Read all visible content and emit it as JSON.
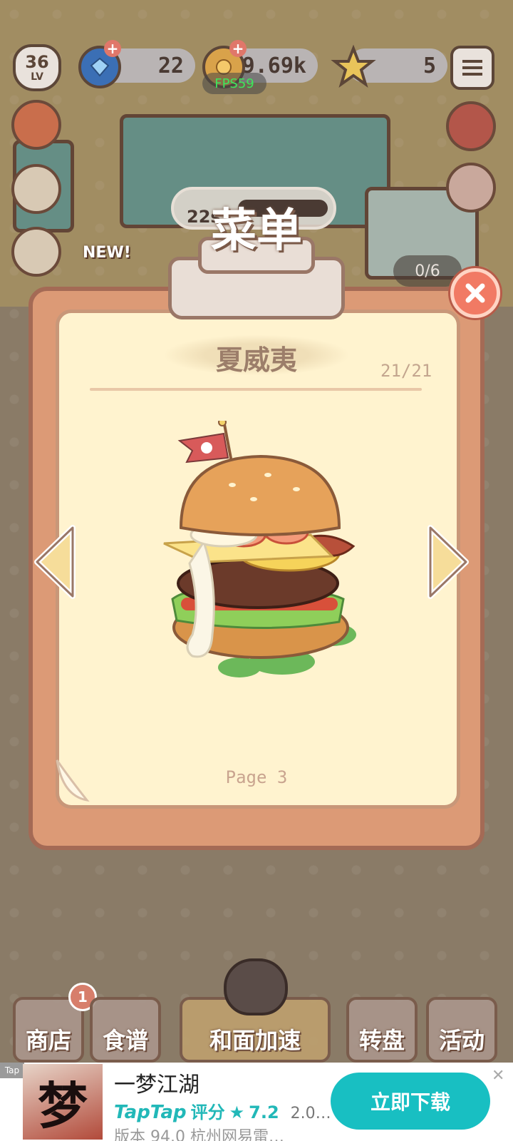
{
  "hud": {
    "level": "36",
    "level_suffix": "LV",
    "gems": "22",
    "coins": "19.69k",
    "stars": "5",
    "fps": "FPS59"
  },
  "scene": {
    "new_tag": "NEW!",
    "timer": "22s",
    "counter": "0/6"
  },
  "menu": {
    "title": "菜单",
    "dish_name": "夏威夷",
    "page_index": "21/21",
    "page_label": "Page 3"
  },
  "bottom_nav": {
    "items": [
      {
        "label": "商店",
        "badge": "1"
      },
      {
        "label": "食谱"
      },
      {
        "label": "和面加速"
      },
      {
        "label": "转盘"
      },
      {
        "label": "活动"
      }
    ]
  },
  "ad": {
    "tag": "Tap",
    "thumb_char": "梦",
    "title": "一梦江湖",
    "rating_brand": "TapTap",
    "rating_label": "评分",
    "rating_value": "7.2",
    "version_short": "2.0…",
    "meta": "版本 94.0  杭州网易雷…",
    "cta": "立即下载",
    "close": "✕"
  },
  "colors": {
    "board": "#dc9a76",
    "paper": "#fff3cf",
    "close": "#f17a64",
    "cta": "#18bfc2",
    "fps": "#3ee65c"
  }
}
